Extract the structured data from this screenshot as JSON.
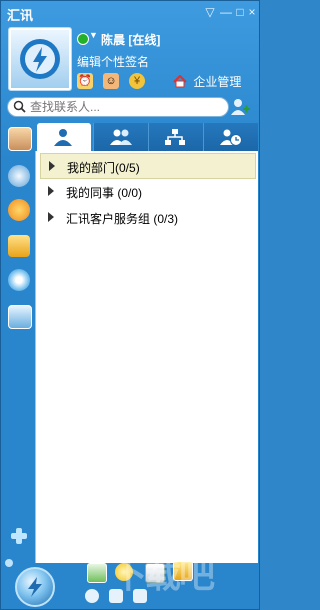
{
  "window": {
    "title": "汇讯",
    "buttons": {
      "menu": "▽",
      "minimize": "—",
      "maximize": "□",
      "close": "×"
    }
  },
  "profile": {
    "name": "陈晨",
    "status": "[在线]",
    "signature": "编辑个性签名",
    "enterprise_label": "企业管理"
  },
  "search": {
    "placeholder": "查找联系人..."
  },
  "tabs": [
    {
      "icon": "person-icon"
    },
    {
      "icon": "people-icon"
    },
    {
      "icon": "org-chart-icon"
    },
    {
      "icon": "recent-clock-icon"
    }
  ],
  "groups": [
    {
      "name": "我的部门",
      "count": "(0/5)"
    },
    {
      "name": "我的同事",
      "count": "(0/0)"
    },
    {
      "name": "汇讯客户服务组",
      "count": "(0/3)"
    }
  ],
  "watermark": "下载吧",
  "colors": {
    "accent": "#2a86cc",
    "selected_row": "#f3f1cf",
    "online": "#23b02a"
  }
}
